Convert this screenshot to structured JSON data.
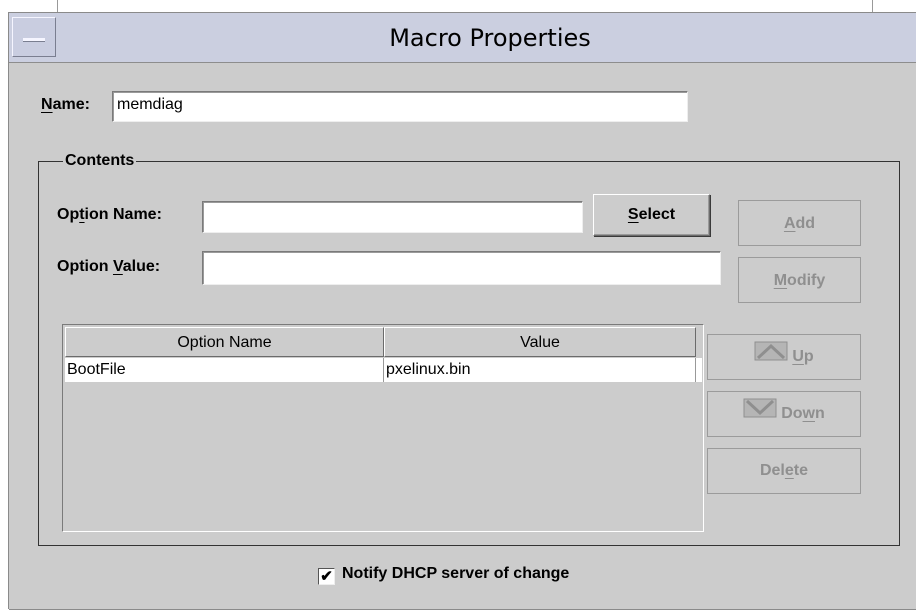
{
  "window": {
    "title": "Macro Properties"
  },
  "name_field": {
    "label": "Name:",
    "value": "memdiag"
  },
  "contents": {
    "group_label": "Contents",
    "option_name_label": "Option Name:",
    "option_name_value": "",
    "option_value_label": "Option Value:",
    "option_value_value": "",
    "select_button": "Select",
    "add_button": "Add",
    "modify_button": "Modify",
    "up_button": "Up",
    "down_button": "Down",
    "delete_button": "Delete",
    "table": {
      "columns": [
        "Option Name",
        "Value"
      ],
      "rows": [
        {
          "option_name": "BootFile",
          "value": "pxelinux.bin"
        }
      ]
    }
  },
  "notify": {
    "label": "Notify DHCP server of change",
    "checked": true,
    "check_glyph": "✔"
  },
  "icons": {
    "up": "chevron-up-icon",
    "down": "chevron-down-icon"
  },
  "colors": {
    "window_bg": "#cccccc",
    "titlebar_bg": "#cbcfe0",
    "disabled_text": "#8f8f8f"
  }
}
